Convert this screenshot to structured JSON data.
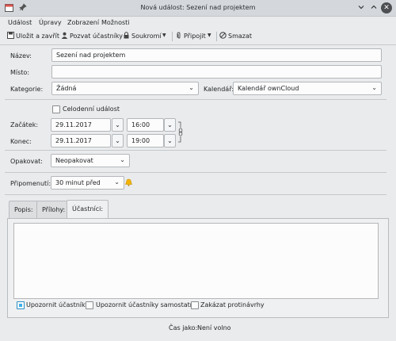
{
  "window": {
    "title": "Nová událost: Sezení nad projektem",
    "icon": "calendar-icon",
    "pin_icon": "pin-icon",
    "minimize_icon": "chevron-down-icon",
    "maximize_icon": "chevron-up-icon",
    "close_icon": "close-icon"
  },
  "menu": [
    "Událost",
    "Úpravy",
    "Zobrazení",
    "Možnosti"
  ],
  "toolbar": {
    "save_close": "Uložit a zavřít",
    "invite": "Pozvat účastníky",
    "private": "Soukromí",
    "attach": "Připojit",
    "delete": "Smazat"
  },
  "form": {
    "name_label": "Název:",
    "name_value": "Sezení nad projektem",
    "place_label": "Místo:",
    "place_value": "",
    "category_label": "Kategorie:",
    "category_value": "Žádná",
    "calendar_label": "Kalendář:",
    "calendar_value": "Kalendář ownCloud",
    "all_day_label": "Celodenní událost",
    "all_day_checked": false,
    "start_label": "Začátek:",
    "start_date": "29.11.2017",
    "start_time": "16:00",
    "end_label": "Konec:",
    "end_date": "29.11.2017",
    "end_time": "19:00",
    "repeat_label": "Opakovat:",
    "repeat_value": "Neopakovat",
    "reminder_label": "Připomenutí:",
    "reminder_value": "30 minut před"
  },
  "tabs": [
    "Popis:",
    "Přílohy:",
    "Účastníci:"
  ],
  "active_tab": "Účastníci:",
  "attendees": {
    "notify_label": "Upozornit účastníky",
    "notify_checked": true,
    "notify_self_label": "Upozornit účastníky samostatně",
    "notify_self_checked": false,
    "forbid_label": "Zakázat protinávrhy",
    "forbid_checked": false
  },
  "status": {
    "label": "Čas jako:",
    "value": "Není volno"
  },
  "colors": {
    "accent": "#3daee9",
    "titlebar": "#d4d8dc",
    "window_bg": "#e9ebed",
    "bell": "#f4b400"
  }
}
